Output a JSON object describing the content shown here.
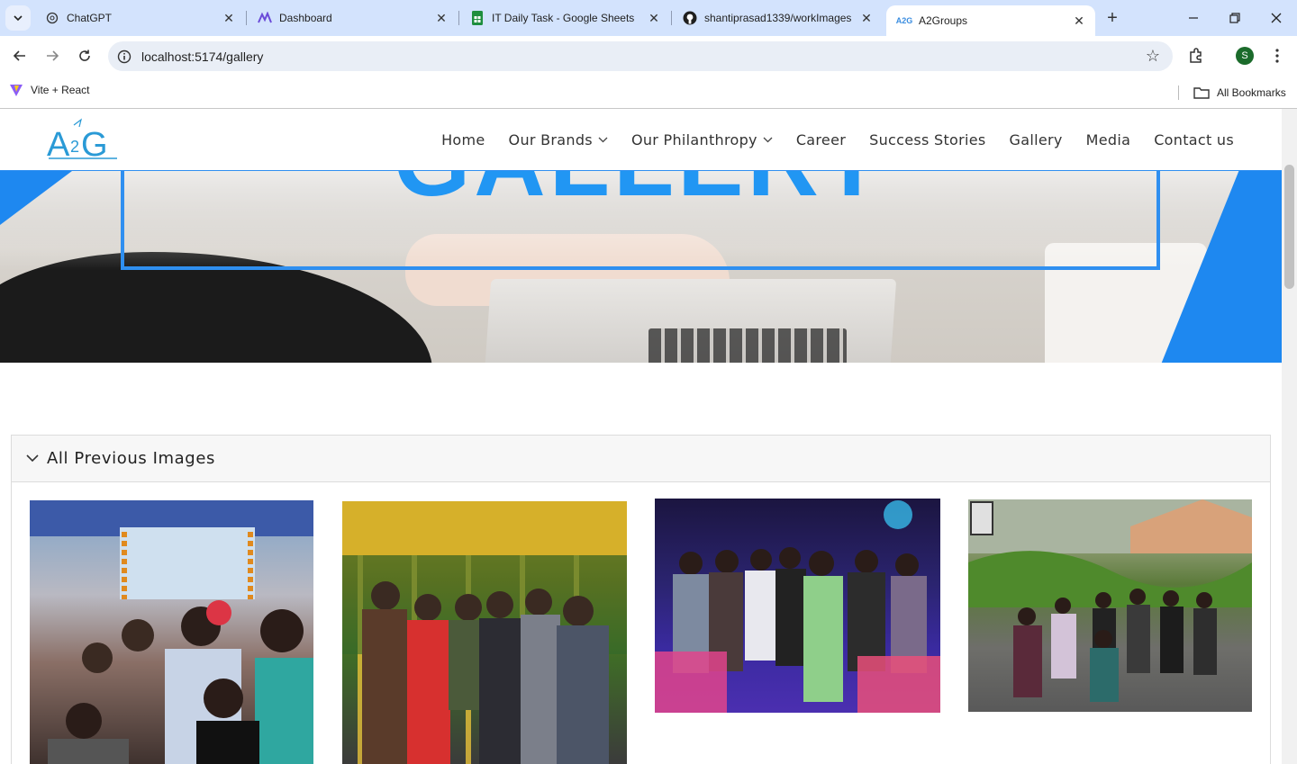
{
  "browser": {
    "tabs": [
      {
        "title": "ChatGPT",
        "icon": "chatgpt-icon"
      },
      {
        "title": "Dashboard",
        "icon": "dashboard-icon"
      },
      {
        "title": "IT Daily Task - Google Sheets",
        "icon": "google-sheets-icon"
      },
      {
        "title": "shantiprasad1339/workImages",
        "icon": "github-icon"
      },
      {
        "title": "A2Groups",
        "icon": "a2g-favicon"
      }
    ],
    "active_tab": 4,
    "url": "localhost:5174/gallery",
    "profile_initial": "S",
    "bookmarks": [
      {
        "label": "Vite + React",
        "icon": "vite-icon"
      }
    ],
    "all_bookmarks_label": "All Bookmarks"
  },
  "site": {
    "logo_text": "A2G",
    "nav": [
      {
        "label": "Home",
        "dropdown": false
      },
      {
        "label": "Our Brands",
        "dropdown": true
      },
      {
        "label": "Our Philanthropy",
        "dropdown": true
      },
      {
        "label": "Career",
        "dropdown": false
      },
      {
        "label": "Success Stories",
        "dropdown": false
      },
      {
        "label": "Gallery",
        "dropdown": false
      },
      {
        "label": "Media",
        "dropdown": false
      },
      {
        "label": "Contact us",
        "dropdown": false
      }
    ],
    "hero_title": "GALLERY",
    "accordion_title": "All Previous Images",
    "brand_color": "#2196f3"
  }
}
